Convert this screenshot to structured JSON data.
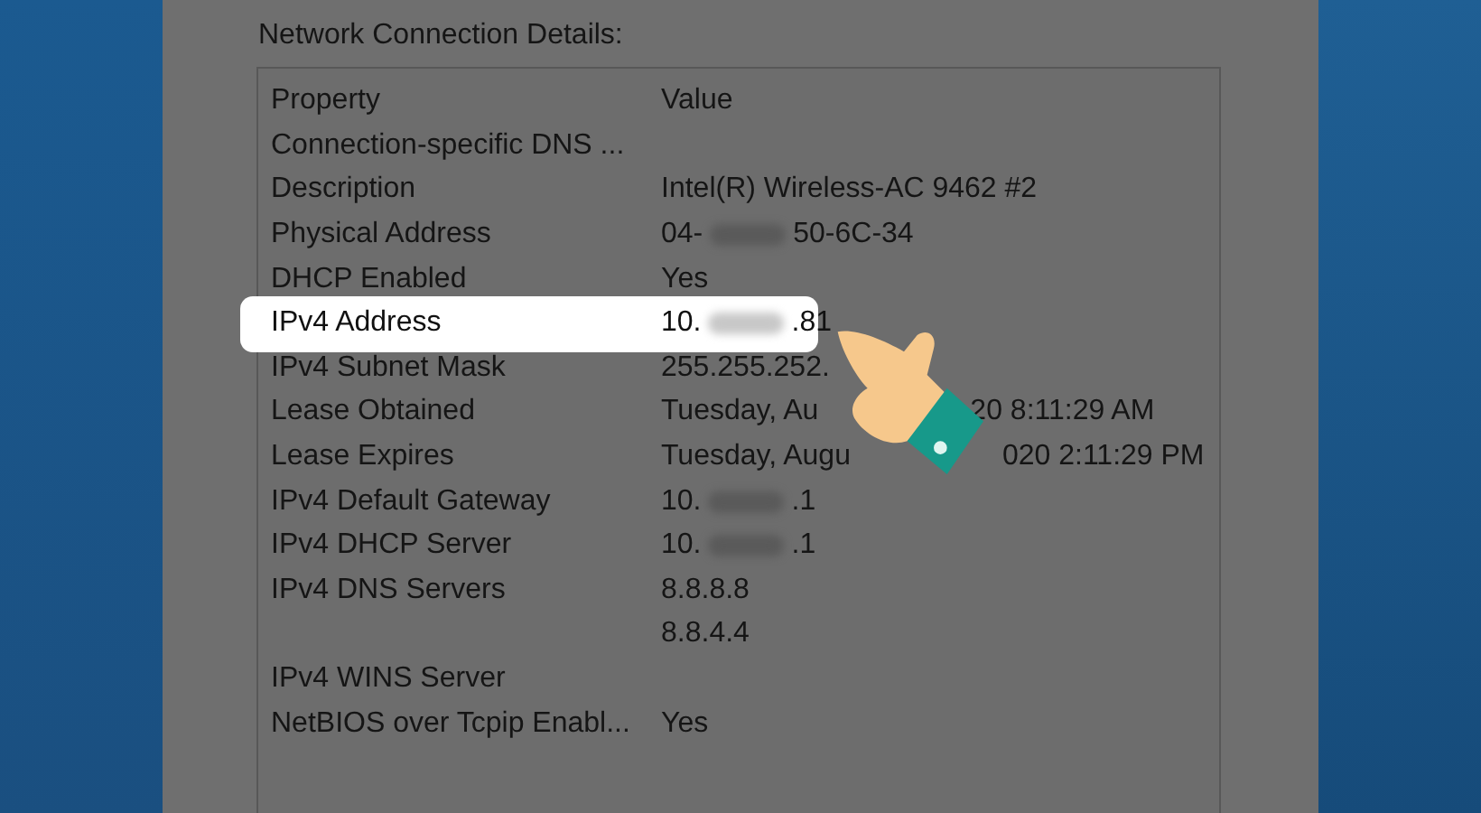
{
  "dialog": {
    "title": "Network Connection Details:"
  },
  "columns": [
    "Property",
    "Value"
  ],
  "rows": [
    {
      "property": "Connection-specific DNS ...",
      "value": [],
      "highlighted": false
    },
    {
      "property": "Description",
      "value": [
        {
          "kind": "text",
          "text": "Intel(R) Wireless-AC 9462 #2"
        }
      ],
      "highlighted": false
    },
    {
      "property": "Physical Address",
      "value": [
        {
          "kind": "text",
          "text": "04-"
        },
        {
          "kind": "blur"
        },
        {
          "kind": "text",
          "text": "50-6C-34"
        }
      ],
      "highlighted": false
    },
    {
      "property": "DHCP Enabled",
      "value": [
        {
          "kind": "text",
          "text": "Yes"
        }
      ],
      "highlighted": false
    },
    {
      "property": "IPv4 Address",
      "value": [
        {
          "kind": "text",
          "text": "10."
        },
        {
          "kind": "blur"
        },
        {
          "kind": "text",
          "text": ".81"
        }
      ],
      "highlighted": true
    },
    {
      "property": "IPv4 Subnet Mask",
      "value": [
        {
          "kind": "text",
          "text": "255.255.252."
        }
      ],
      "highlighted": false
    },
    {
      "property": "Lease Obtained",
      "value": [
        {
          "kind": "text",
          "text": "Tuesday, Au"
        },
        {
          "kind": "covered"
        },
        {
          "kind": "text",
          "text": "20 8:11:29 AM"
        }
      ],
      "highlighted": false
    },
    {
      "property": "Lease Expires",
      "value": [
        {
          "kind": "text",
          "text": "Tuesday, Augu"
        },
        {
          "kind": "covered"
        },
        {
          "kind": "text",
          "text": "020 2:11:29 PM"
        }
      ],
      "highlighted": false
    },
    {
      "property": "IPv4 Default Gateway",
      "value": [
        {
          "kind": "text",
          "text": "10."
        },
        {
          "kind": "blur"
        },
        {
          "kind": "text",
          "text": ".1"
        }
      ],
      "highlighted": false
    },
    {
      "property": "IPv4 DHCP Server",
      "value": [
        {
          "kind": "text",
          "text": "10."
        },
        {
          "kind": "blur"
        },
        {
          "kind": "text",
          "text": ".1"
        }
      ],
      "highlighted": false
    },
    {
      "property": "IPv4 DNS Servers",
      "value": [
        {
          "kind": "text",
          "text": "8.8.8.8"
        }
      ],
      "highlighted": false
    },
    {
      "property": "",
      "value": [
        {
          "kind": "text",
          "text": "8.8.4.4"
        }
      ],
      "highlighted": false
    },
    {
      "property": "IPv4 WINS Server",
      "value": [],
      "highlighted": false
    },
    {
      "property": "NetBIOS over Tcpip Enabl...",
      "value": [
        {
          "kind": "text",
          "text": "Yes"
        }
      ],
      "highlighted": false
    }
  ]
}
